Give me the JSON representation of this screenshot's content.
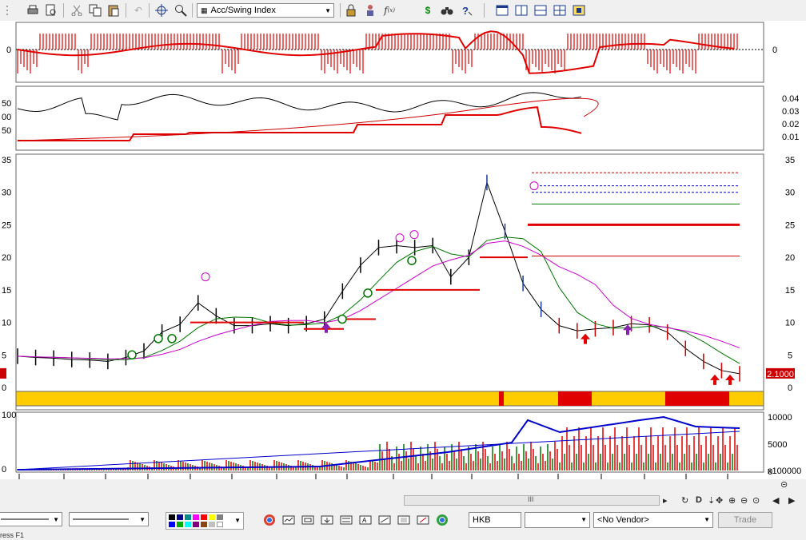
{
  "toolbar": {
    "indicator_combo": "Acc/Swing Index",
    "icons": [
      "print-icon",
      "preview-icon",
      "cut-icon",
      "copy-icon",
      "paste-icon",
      "undo-icon",
      "crosshair-icon",
      "zoom-icon",
      "lock-icon",
      "person-icon",
      "function-icon",
      "dollar-icon",
      "binoculars-icon",
      "help-icon",
      "layout1-icon",
      "layout2-icon",
      "layout3-icon",
      "layout4-icon",
      "layout5-icon"
    ]
  },
  "chart_data": [
    {
      "type": "line",
      "name": "acc-swing-panel",
      "yticks": [
        "0"
      ],
      "right_ticks": [
        "0"
      ]
    },
    {
      "type": "line",
      "name": "secondary-panel",
      "left_ticks": [
        "50",
        "00",
        "50"
      ],
      "right_ticks": [
        "0.04",
        "0.03",
        "0.02",
        "0.01"
      ]
    },
    {
      "type": "line",
      "name": "price-panel",
      "left_ticks": [
        "35",
        "30",
        "25",
        "20",
        "15",
        "10",
        "5",
        "0"
      ],
      "right_ticks": [
        "35",
        "30",
        "25",
        "20",
        "15",
        "10",
        "5",
        "0"
      ],
      "last_price_label": "2.1000",
      "left_price_label": "0",
      "x_labels": [
        "Jul",
        "Aug",
        "Sep",
        "Oct",
        "Nov",
        "Dec",
        "2016",
        "Feb",
        "Mar",
        "Apr",
        "May",
        "Jun",
        "Jul",
        "Aug",
        "Sep",
        "Oct",
        "Nov",
        "Dec"
      ],
      "close": [
        4.8,
        4.6,
        4.5,
        4.3,
        4.2,
        4.0,
        4.6,
        5.6,
        8.5,
        9.7,
        13.0,
        11.0,
        9.5,
        9.5,
        9.8,
        9.5,
        9.8,
        10.5,
        14.8,
        18.8,
        21.5,
        21.8,
        21.5,
        21.8,
        17.0,
        20.0,
        31.5,
        24.0,
        16.0,
        12.0,
        9.5,
        8.7,
        9.0,
        9.2,
        9.8,
        9.6,
        8.5,
        6.0,
        4.0,
        2.6,
        2.1
      ],
      "ylim": [
        0,
        35
      ]
    },
    {
      "type": "bar",
      "name": "volume-panel",
      "left_ticks": [
        "100",
        "0"
      ],
      "right_ticks": [
        "10000",
        "5000",
        "0"
      ],
      "unit_label": "x100000"
    }
  ],
  "bottom": {
    "symbol": "HKB",
    "vendor": "<No Vendor>",
    "trade_label": "Trade",
    "scroll_grip": "III"
  },
  "status_text": "ress F1",
  "colors": {
    "red": "#e00000",
    "green": "#007700",
    "blue": "#0000cc",
    "yellow": "#ffcc00",
    "magenta": "#cc00cc"
  }
}
